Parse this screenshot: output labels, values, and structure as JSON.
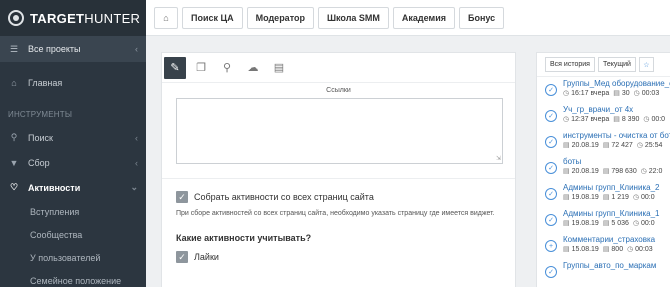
{
  "app": {
    "logo_bold": "TARGET",
    "logo_thin": "HUNTER"
  },
  "sidebar": {
    "projects_label": "Все проекты",
    "home_label": "Главная",
    "tools_section": "ИНСТРУМЕНТЫ",
    "search_label": "Поиск",
    "collect_label": "Сбор",
    "activity_label": "Активности",
    "sub_items": [
      "Вступления",
      "Сообщества",
      "У пользователей",
      "Семейное положение"
    ]
  },
  "topbar": {
    "buttons": [
      "Поиск ЦА",
      "Модератор",
      "Школа SMM",
      "Академия",
      "Бонус"
    ]
  },
  "main": {
    "links_label": "Ссылки",
    "links_value": "",
    "collect_all_label": "Собрать активности со всех страниц сайта",
    "collect_all_checked": true,
    "hint": "При сборе активностей со всех страниц сайта, необходимо указать страницу где имеется виджет.",
    "question": "Какие активности учитывать?",
    "likes_label": "Лайки",
    "likes_checked": true
  },
  "history": {
    "all_label": "Вся история",
    "current_label": "Текущий",
    "items": [
      {
        "title": "Группы_Мед оборудование_с",
        "date": "16:17 вчера",
        "count": "30",
        "time": "00:03"
      },
      {
        "title": "Уч_гр_врачи_от 4х",
        "date": "12:37 вчера",
        "count": "8 390",
        "time": "00:0"
      },
      {
        "title": "инструменты - очистка от бот",
        "date": "20.08.19",
        "count": "72 427",
        "time": "25:54"
      },
      {
        "title": "боты",
        "date": "20.08.19",
        "count": "798 630",
        "time": "22:0"
      },
      {
        "title": "Админы групп_Клиника_2",
        "date": "19.08.19",
        "count": "1 219",
        "time": "00:0"
      },
      {
        "title": "Админы групп_Клиника_1",
        "date": "19.08.19",
        "count": "5 036",
        "time": "00:0"
      },
      {
        "title": "Комментарии_страховка",
        "date": "15.08.19",
        "count": "800",
        "time": "00:03"
      },
      {
        "title": "Группы_авто_по_маркам",
        "date": "",
        "count": "",
        "time": ""
      }
    ]
  }
}
